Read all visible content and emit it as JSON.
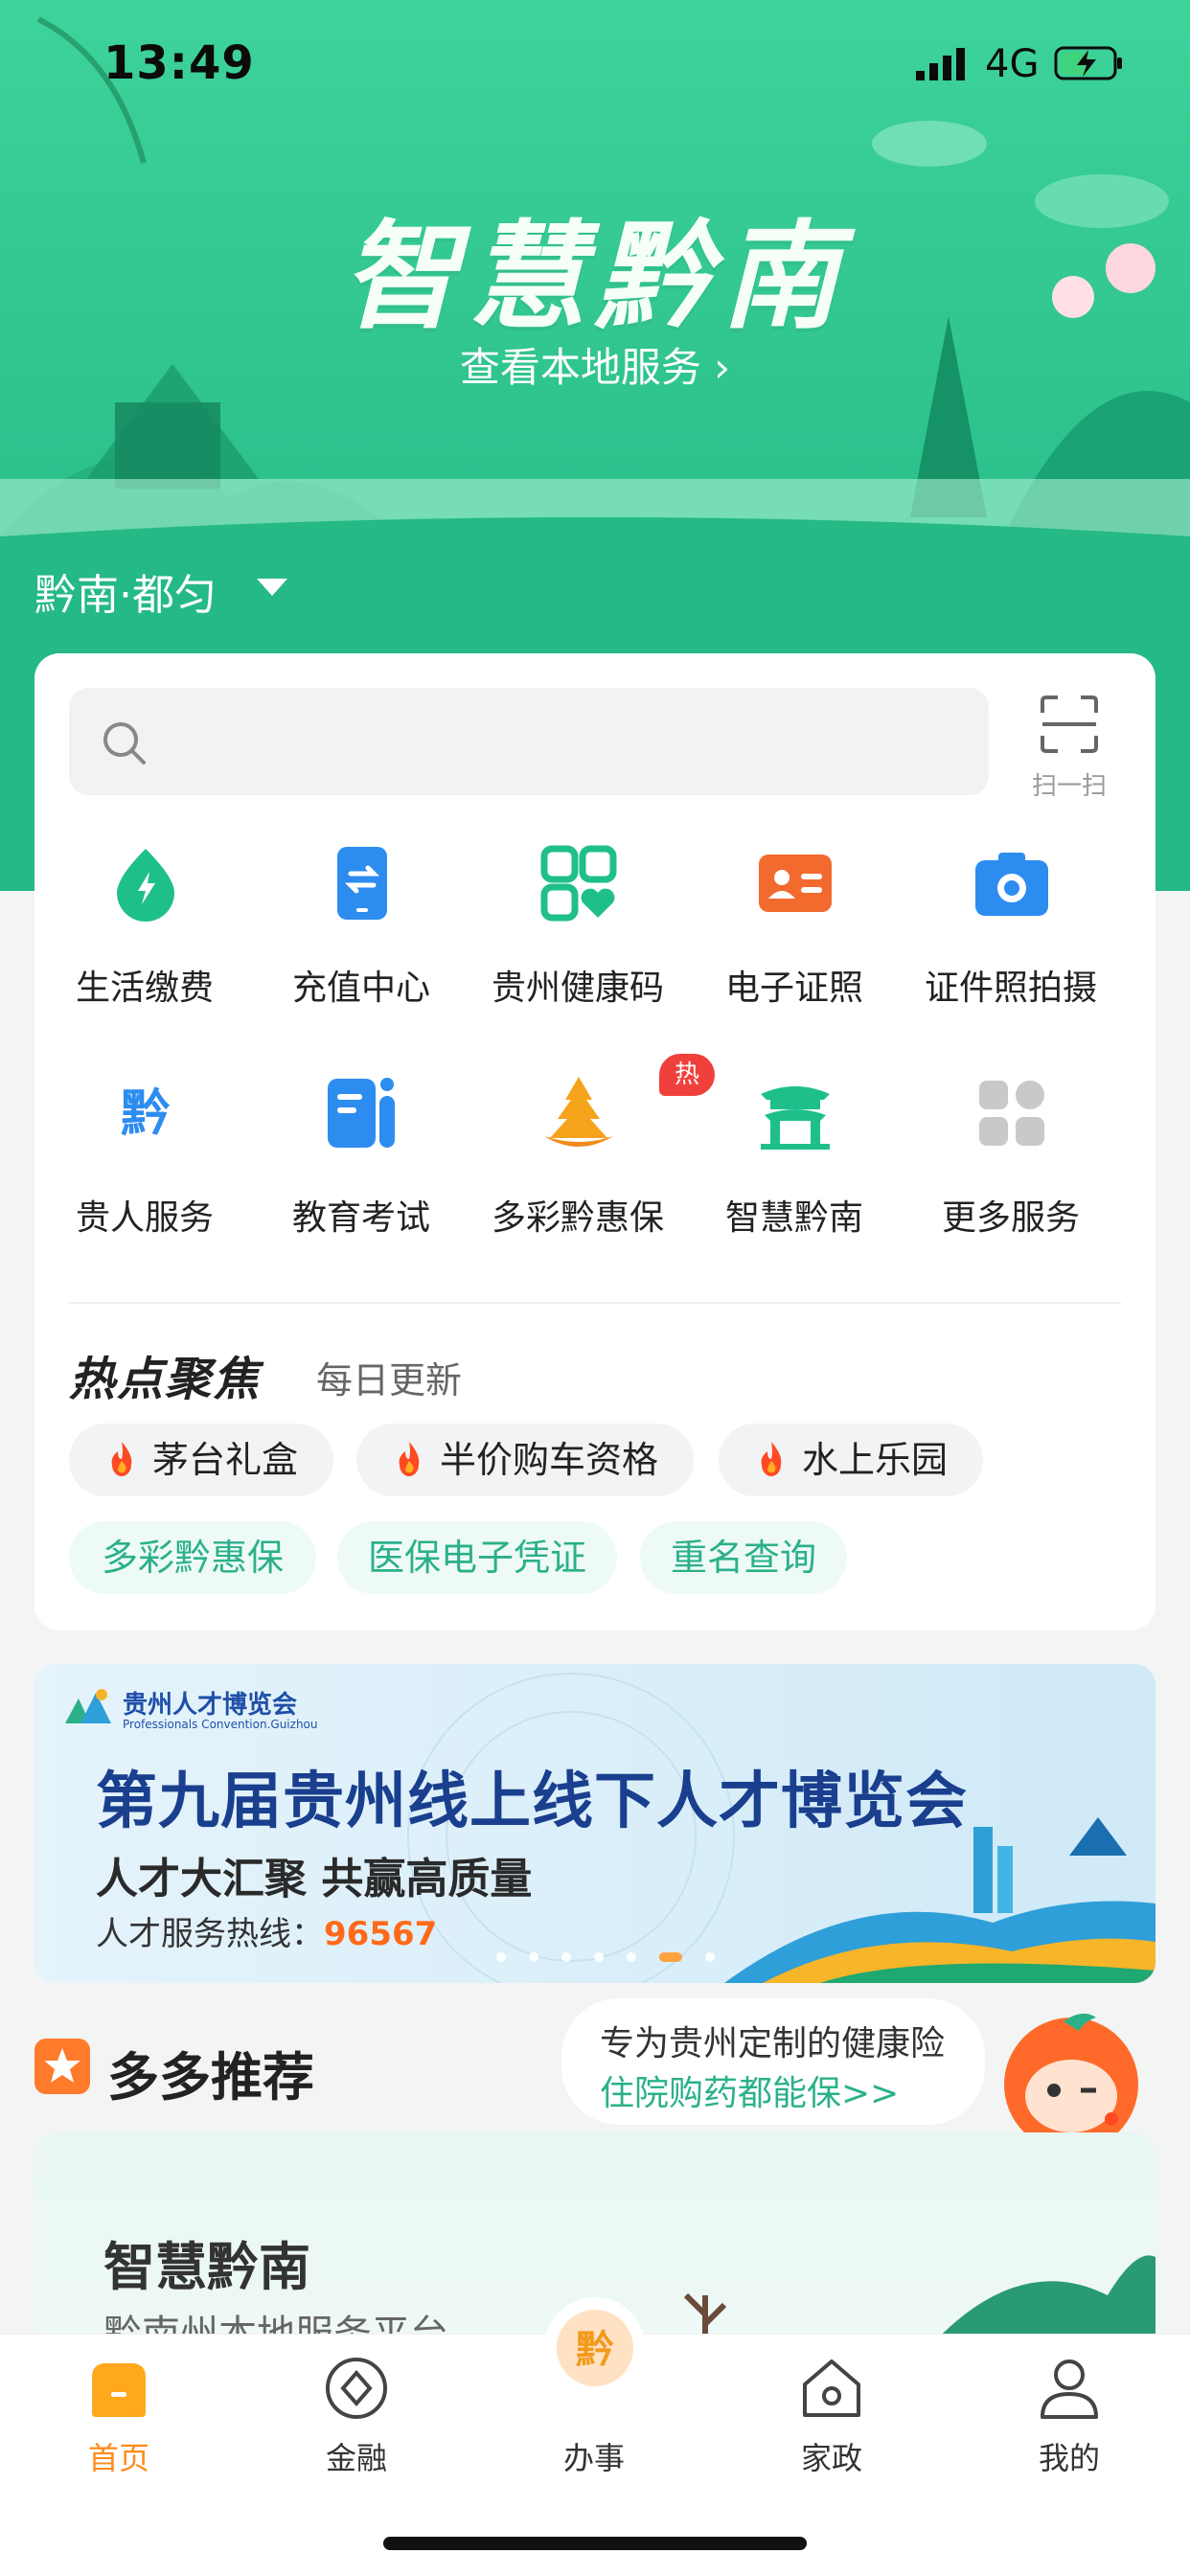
{
  "status": {
    "time": "13:49",
    "network": "4G"
  },
  "hero": {
    "title": "智慧黔南",
    "link": "查看本地服务 ›",
    "location": "黔南·都匀"
  },
  "search": {
    "placeholder": "",
    "scan_label": "扫一扫"
  },
  "services": [
    {
      "label": "生活缴费",
      "icon": "drop-bolt-icon"
    },
    {
      "label": "充值中心",
      "icon": "phone-recharge-icon"
    },
    {
      "label": "贵州健康码",
      "icon": "health-code-icon"
    },
    {
      "label": "电子证照",
      "icon": "id-card-icon"
    },
    {
      "label": "证件照拍摄",
      "icon": "camera-icon"
    },
    {
      "label": "贵人服务",
      "icon": "guiren-logo-icon"
    },
    {
      "label": "教育考试",
      "icon": "education-icon"
    },
    {
      "label": "多彩黔惠保",
      "icon": "duocai-icon"
    },
    {
      "label": "智慧黔南",
      "icon": "qiannan-gate-icon"
    },
    {
      "label": "更多服务",
      "icon": "more-grid-icon"
    }
  ],
  "hot_badge": "热",
  "focus": {
    "title": "热点聚焦",
    "subtitle": "每日更新",
    "hot_tags": [
      "茅台礼盒",
      "半价购车资格",
      "水上乐园"
    ],
    "tags": [
      "多彩黔惠保",
      "医保电子凭证",
      "重名查询"
    ]
  },
  "banner": {
    "logo_text": "贵州人才博览会",
    "logo_sub": "Professionals Convention.Guizhou",
    "title": "第九届贵州线上线下人才博览会",
    "subtitle": "人才大汇聚 共赢高质量",
    "hotline_label": "人才服务热线：",
    "hotline_number": "96567",
    "active_dot": 5,
    "dot_count": 7
  },
  "recommend": {
    "title": "多多推荐",
    "bubble_line1": "专为贵州定制的健康险",
    "bubble_line2": "住院购药都能保>>",
    "card_title": "智慧黔南",
    "card_subtitle": "黔南州本地服务平台"
  },
  "tabs": [
    {
      "label": "首页",
      "active": true
    },
    {
      "label": "金融",
      "active": false
    },
    {
      "label": "办事",
      "active": false
    },
    {
      "label": "家政",
      "active": false
    },
    {
      "label": "我的",
      "active": false
    }
  ],
  "colors": {
    "brand_green": "#2bb08a",
    "active_orange": "#ff8a1a",
    "hot_red": "#f0403b"
  }
}
